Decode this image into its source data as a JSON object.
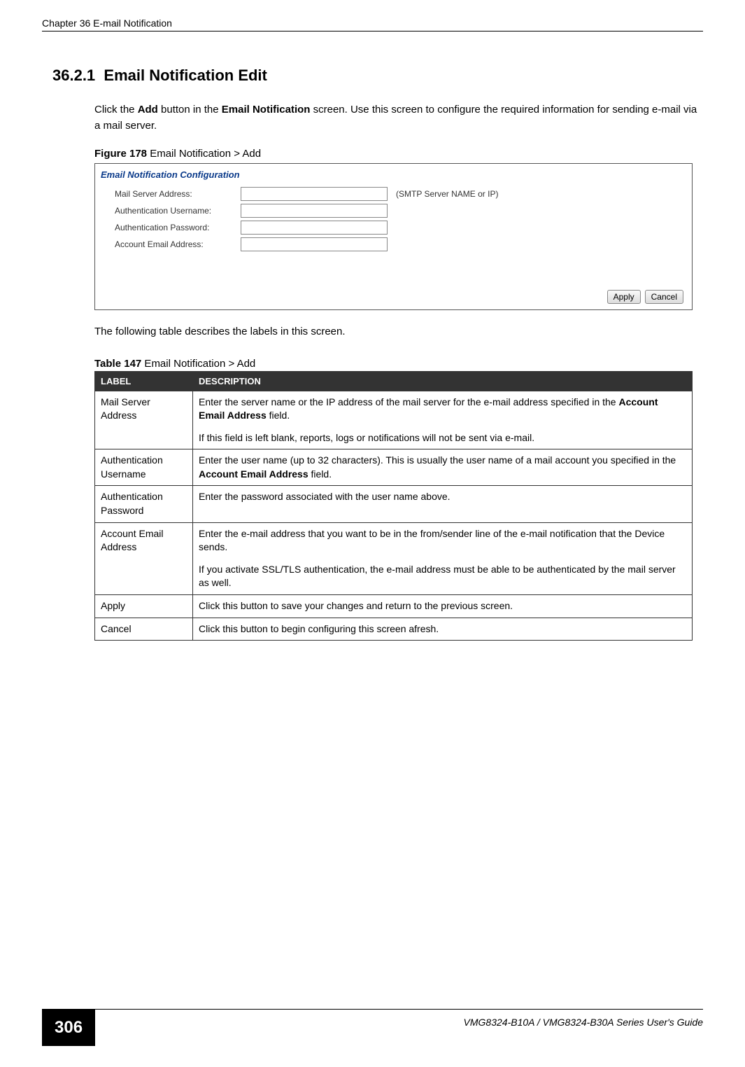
{
  "header": {
    "chapter": "Chapter 36 E-mail Notification"
  },
  "section": {
    "number": "36.2.1",
    "title": "Email Notification Edit"
  },
  "intro": {
    "p1a": "Click the ",
    "p1b": "Add",
    "p1c": " button in the ",
    "p1d": "Email Notification",
    "p1e": " screen. Use this screen to configure the required information for sending e-mail via a mail server."
  },
  "figure": {
    "label_prefix": "Figure 178",
    "label_suffix": "   Email Notification > Add",
    "title": "Email Notification Configuration",
    "rows": {
      "mail_server": "Mail Server Address:",
      "mail_server_hint": "(SMTP Server NAME or IP)",
      "auth_user": "Authentication Username:",
      "auth_pass": "Authentication Password:",
      "account_email": "Account Email Address:"
    },
    "buttons": {
      "apply": "Apply",
      "cancel": "Cancel"
    }
  },
  "table_intro": "The following table describes the labels in this screen.",
  "table": {
    "label_prefix": "Table 147",
    "label_suffix": "   Email Notification > Add",
    "headers": {
      "label": "LABEL",
      "desc": "DESCRIPTION"
    },
    "rows": [
      {
        "label": "Mail Server Address",
        "desc_p1a": "Enter the server name or the IP address of the mail server for the e-mail address specified in the ",
        "desc_p1b": "Account Email Address",
        "desc_p1c": " field.",
        "desc_p2": "If this field is left blank, reports, logs or notifications will not be sent via e-mail."
      },
      {
        "label": "Authentication Username",
        "desc_p1a": "Enter the user name (up to 32 characters). This is usually the user name of a mail account you specified in the ",
        "desc_p1b": "Account Email Address",
        "desc_p1c": " field."
      },
      {
        "label": "Authentication Password",
        "desc_p1": "Enter the password associated with the user name above."
      },
      {
        "label": "Account Email Address",
        "desc_p1": "Enter the e-mail address that you want to be in the from/sender line of the e-mail notification that the Device sends.",
        "desc_p2": "If you activate SSL/TLS authentication, the e-mail address must be able to be authenticated by the mail server as well."
      },
      {
        "label": "Apply",
        "desc_p1": "Click this button to save your changes and return to the previous screen."
      },
      {
        "label": "Cancel",
        "desc_p1": "Click this button to begin configuring this screen afresh."
      }
    ]
  },
  "footer": {
    "page": "306",
    "guide": "VMG8324-B10A / VMG8324-B30A Series User's Guide"
  }
}
